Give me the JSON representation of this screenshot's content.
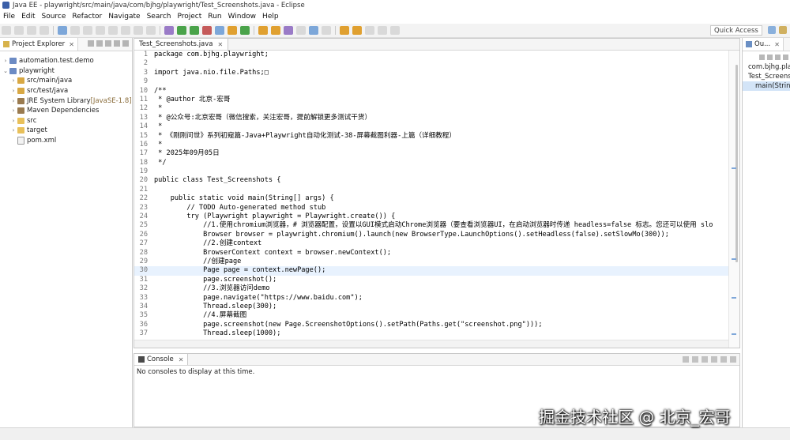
{
  "window": {
    "title": "Java EE - playwright/src/main/java/com/bjhg/playwright/Test_Screenshots.java - Eclipse"
  },
  "menu": [
    "File",
    "Edit",
    "Source",
    "Refactor",
    "Navigate",
    "Search",
    "Project",
    "Run",
    "Window",
    "Help"
  ],
  "toolbar": {
    "quick_access": "Quick Access"
  },
  "explorer": {
    "tab_label": "Project Explorer",
    "close": "✕",
    "items": [
      {
        "arrow": "›",
        "label": "automation.test.demo",
        "decor": "",
        "icon": "project",
        "indent": 0
      },
      {
        "arrow": "⌄",
        "label": "playwright",
        "decor": "",
        "icon": "project",
        "indent": 0
      },
      {
        "arrow": "›",
        "label": "src/main/java",
        "decor": "",
        "icon": "package",
        "indent": 1
      },
      {
        "arrow": "›",
        "label": "src/test/java",
        "decor": "",
        "icon": "package",
        "indent": 1
      },
      {
        "arrow": "›",
        "label": "JRE System Library ",
        "decor": "[JavaSE-1.8]",
        "icon": "library",
        "indent": 1
      },
      {
        "arrow": "›",
        "label": "Maven Dependencies",
        "decor": "",
        "icon": "library",
        "indent": 1
      },
      {
        "arrow": "›",
        "label": "src",
        "decor": "",
        "icon": "folder",
        "indent": 1
      },
      {
        "arrow": "›",
        "label": "target",
        "decor": "",
        "icon": "folder",
        "indent": 1
      },
      {
        "arrow": "",
        "label": "pom.xml",
        "decor": "",
        "icon": "file",
        "indent": 1
      }
    ]
  },
  "editor": {
    "tab_label": "Test_Screenshots.java",
    "close": "✕",
    "current_line": 30,
    "lines": [
      {
        "n": "1",
        "t": "package com.bjhg.playwright;"
      },
      {
        "n": "2",
        "t": ""
      },
      {
        "n": "3",
        "t": "import java.nio.file.Paths;□"
      },
      {
        "n": "9",
        "t": ""
      },
      {
        "n": "10",
        "t": "/**"
      },
      {
        "n": "11",
        "t": " * @author 北京-宏哥"
      },
      {
        "n": "12",
        "t": " *"
      },
      {
        "n": "13",
        "t": " * @公众号:北京宏哥（微信搜索，关注宏哥，提前解锁更多测试干货）"
      },
      {
        "n": "14",
        "t": " *"
      },
      {
        "n": "15",
        "t": " * 《刚刚问世》系列初窥篇-Java+Playwright自动化测试-38-屏幕截图利器-上篇（详细教程）"
      },
      {
        "n": "16",
        "t": " *"
      },
      {
        "n": "17",
        "t": " * 2025年09月05日"
      },
      {
        "n": "18",
        "t": " */"
      },
      {
        "n": "19",
        "t": ""
      },
      {
        "n": "20",
        "t": "public class Test_Screenshots {"
      },
      {
        "n": "21",
        "t": ""
      },
      {
        "n": "22",
        "t": "    public static void main(String[] args) {"
      },
      {
        "n": "23",
        "t": "        // TODO Auto-generated method stub"
      },
      {
        "n": "24",
        "t": "        try (Playwright playwright = Playwright.create()) {"
      },
      {
        "n": "25",
        "t": "            //1.使用chromium浏览器，# 浏览器配置，设置以GUI模式启动Chrome浏览器（要查看浏览器UI，在启动浏览器时传递 headless=false 标志。您还可以使用 slo"
      },
      {
        "n": "26",
        "t": "            Browser browser = playwright.chromium().launch(new BrowserType.LaunchOptions().setHeadless(false).setSlowMo(300));"
      },
      {
        "n": "27",
        "t": "            //2.创建context"
      },
      {
        "n": "28",
        "t": "            BrowserContext context = browser.newContext();"
      },
      {
        "n": "29",
        "t": "            //创建page"
      },
      {
        "n": "30",
        "t": "            Page page = context.newPage();"
      },
      {
        "n": "31",
        "t": "            page.screenshot();"
      },
      {
        "n": "32",
        "t": "            //3.浏览器访问demo"
      },
      {
        "n": "33",
        "t": "            page.navigate(\"https://www.baidu.com\");"
      },
      {
        "n": "34",
        "t": "            Thread.sleep(300);"
      },
      {
        "n": "35",
        "t": "            //4.屏幕截图"
      },
      {
        "n": "36",
        "t": "            page.screenshot(new Page.ScreenshotOptions().setPath(Paths.get(\"screenshot.png\")));"
      },
      {
        "n": "37",
        "t": "            Thread.sleep(1000);"
      }
    ]
  },
  "console": {
    "tab_label": "Console",
    "close": "✕",
    "message": "No consoles to display at this time."
  },
  "outline": {
    "tab_label": "Ou...",
    "close": "✕",
    "items": [
      {
        "label": "com.bjhg.playwright",
        "icon": "pkg",
        "indent": 0,
        "sel": false
      },
      {
        "label": "Test_Screenshots",
        "icon": "cls",
        "indent": 0,
        "sel": false
      },
      {
        "label": "main(String[]) : void",
        "icon": "mth",
        "indent": 1,
        "sel": true
      }
    ]
  },
  "watermark": "掘金技术社区 @ 北京_宏哥"
}
